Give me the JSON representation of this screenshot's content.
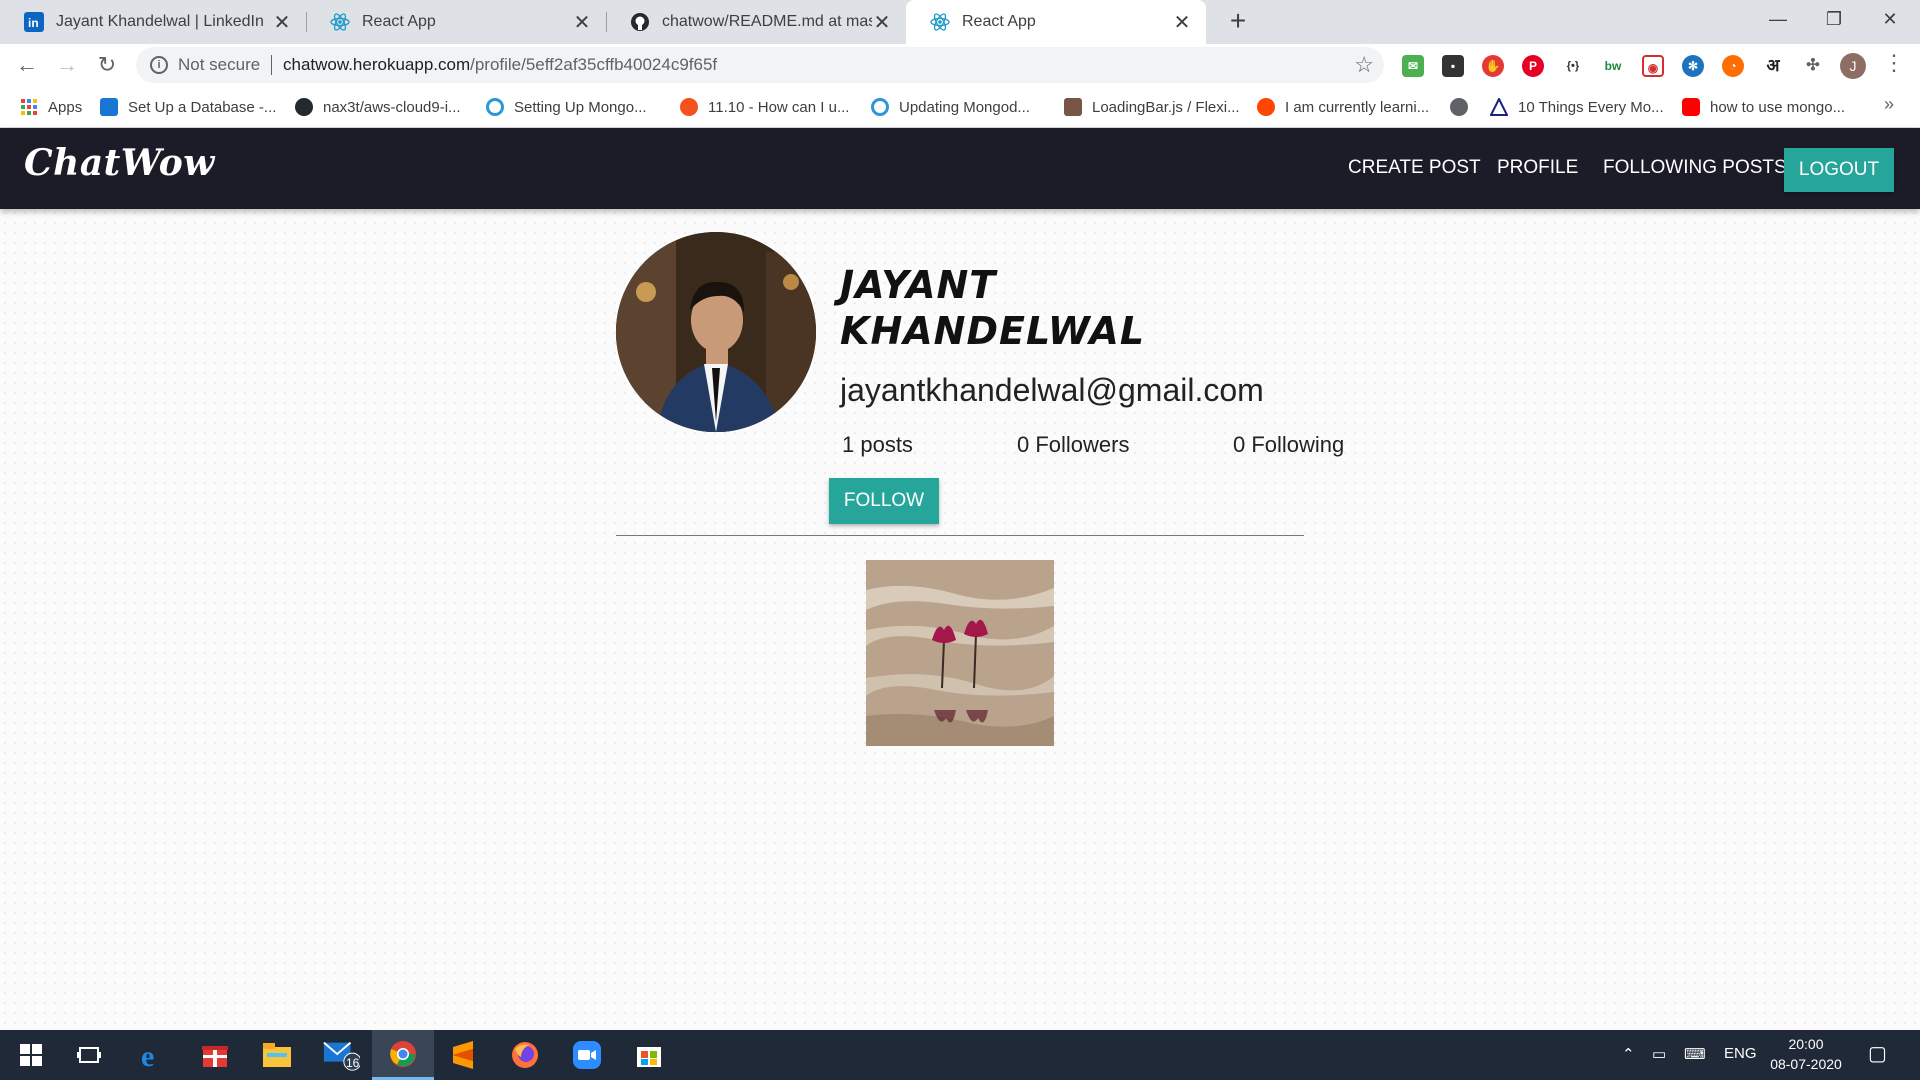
{
  "browser": {
    "tabs": [
      {
        "title": "Jayant Khandelwal | LinkedIn",
        "icon": "linkedin-icon"
      },
      {
        "title": "React App",
        "icon": "react-icon"
      },
      {
        "title": "chatwow/README.md at master",
        "icon": "github-icon"
      },
      {
        "title": "React App",
        "icon": "react-icon"
      }
    ],
    "active_tab": 3,
    "address": {
      "security": "Not secure",
      "host": "chatwow.herokuapp.com",
      "path": "/profile/5eff2af35cffb40024c9f65f"
    },
    "profile_initial": "J",
    "bookmarks": [
      {
        "label": "Apps",
        "icon": "apps-grid-icon"
      },
      {
        "label": "Set Up a Database -...",
        "icon": "database-icon"
      },
      {
        "label": "nax3t/aws-cloud9-i...",
        "icon": "github-icon"
      },
      {
        "label": "Setting Up Mongo...",
        "icon": "cloud9-icon"
      },
      {
        "label": "11.10 - How can I u...",
        "icon": "ask-icon"
      },
      {
        "label": "Updating Mongod...",
        "icon": "cloud9-icon"
      },
      {
        "label": "LoadingBar.js / Flexi...",
        "icon": "puzzle-icon"
      },
      {
        "label": "I am currently learni...",
        "icon": "reddit-icon"
      },
      {
        "label": "",
        "icon": "globe-icon"
      },
      {
        "label": "10 Things Every Mo...",
        "icon": "triangle-logo-icon"
      },
      {
        "label": "how to use mongo...",
        "icon": "youtube-icon"
      }
    ]
  },
  "app": {
    "brand": "ChatWow",
    "nav": [
      "CREATE POST",
      "PROFILE",
      "FOLLOWING POSTS"
    ],
    "logout_label": "LOGOUT"
  },
  "profile": {
    "name": "JAYANT KHANDELWAL",
    "email": "jayantkhandelwal@gmail.com",
    "posts": "1 posts",
    "followers": "0 Followers",
    "following": "0 Following",
    "follow_label": "FOLLOW"
  },
  "taskbar": {
    "mail_badge": "16",
    "language": "ENG",
    "time": "20:00",
    "date": "08-07-2020"
  },
  "colors": {
    "accent": "#26a69a",
    "navbar": "#1c1c29",
    "tabstrip": "#dee1e6",
    "taskbar": "#1f2937"
  }
}
